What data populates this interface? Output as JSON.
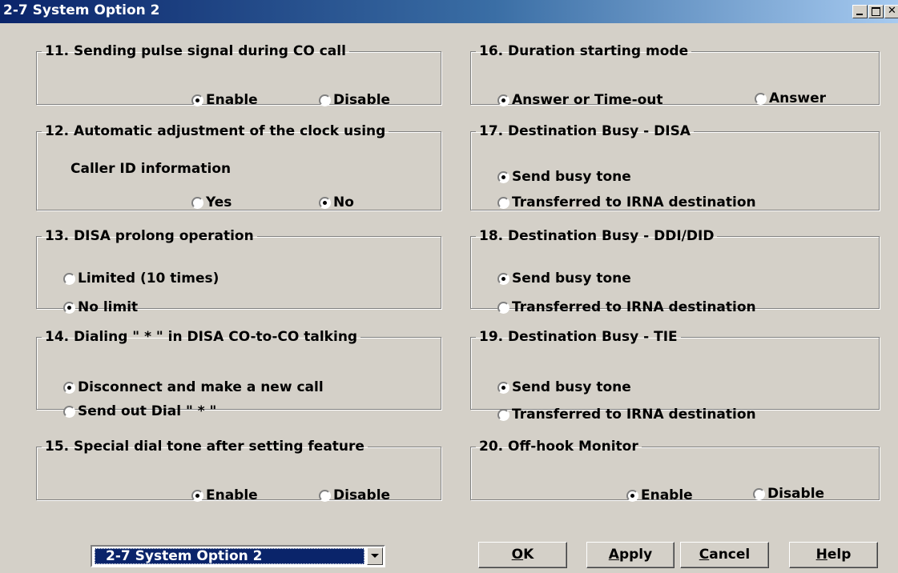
{
  "window": {
    "title": "2-7 System Option 2"
  },
  "groups": {
    "g11": {
      "title": "11. Sending pulse signal during CO call",
      "options": [
        {
          "label": "Enable",
          "selected": true
        },
        {
          "label": "Disable",
          "selected": false
        }
      ]
    },
    "g12": {
      "title": "12. Automatic adjustment of the clock using",
      "subtitle": "Caller ID information",
      "options": [
        {
          "label": "Yes",
          "selected": false
        },
        {
          "label": "No",
          "selected": true
        }
      ]
    },
    "g13": {
      "title": "13. DISA prolong operation",
      "options": [
        {
          "label": "Limited (10 times)",
          "selected": false
        },
        {
          "label": "No limit",
          "selected": true
        }
      ]
    },
    "g14": {
      "title": "14. Dialing \" * \" in DISA CO-to-CO talking",
      "options": [
        {
          "label": "Disconnect and make a new call",
          "selected": true
        },
        {
          "label": "Send out Dial \" * \"",
          "selected": false
        }
      ]
    },
    "g15": {
      "title": "15. Special dial tone after setting feature",
      "options": [
        {
          "label": "Enable",
          "selected": true
        },
        {
          "label": "Disable",
          "selected": false
        }
      ]
    },
    "g16": {
      "title": "16. Duration starting mode",
      "options": [
        {
          "label": "Answer or Time-out",
          "selected": true
        },
        {
          "label": "Answer",
          "selected": false
        }
      ]
    },
    "g17": {
      "title": "17. Destination Busy - DISA",
      "options": [
        {
          "label": "Send busy tone",
          "selected": true
        },
        {
          "label": "Transferred to IRNA destination",
          "selected": false
        }
      ]
    },
    "g18": {
      "title": "18. Destination Busy - DDI/DID",
      "options": [
        {
          "label": "Send busy tone",
          "selected": true
        },
        {
          "label": "Transferred to IRNA destination",
          "selected": false
        }
      ]
    },
    "g19": {
      "title": "19. Destination Busy - TIE",
      "options": [
        {
          "label": "Send busy tone",
          "selected": true
        },
        {
          "label": "Transferred to IRNA destination",
          "selected": false
        }
      ]
    },
    "g20": {
      "title": "20. Off-hook Monitor",
      "options": [
        {
          "label": "Enable",
          "selected": true
        },
        {
          "label": "Disable",
          "selected": false
        }
      ]
    }
  },
  "page_selector": {
    "value": "2-7 System Option 2"
  },
  "buttons": {
    "ok": {
      "accel": "O",
      "rest": "K"
    },
    "apply": {
      "accel": "A",
      "rest": "pply"
    },
    "cancel": {
      "accel": "C",
      "rest": "ancel"
    },
    "help": {
      "accel": "H",
      "rest": "elp"
    }
  },
  "colors": {
    "face": "#d4d0c8",
    "title_bar": "#0a246a",
    "selection": "#0a246a"
  }
}
